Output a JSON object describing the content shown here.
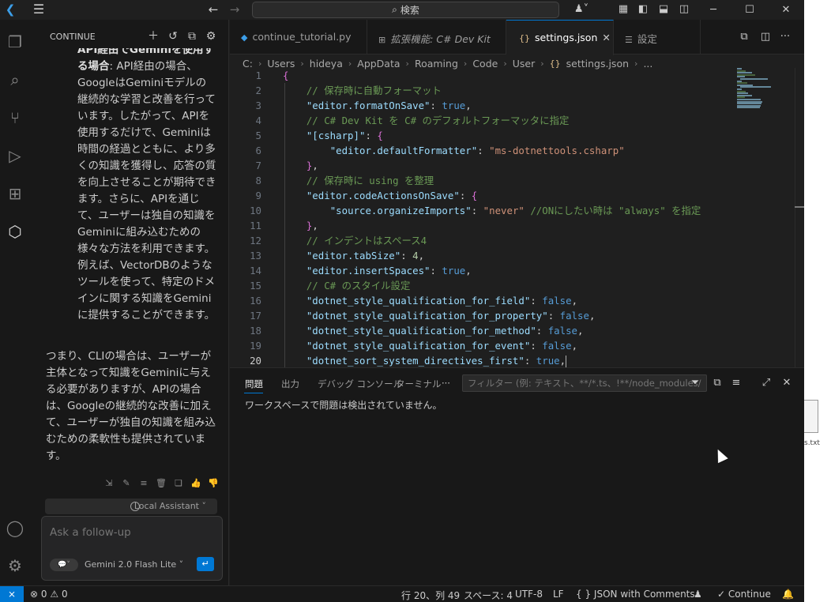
{
  "titlebar": {
    "search_label": "検索",
    "search_icon": "search-icon"
  },
  "sidebar": {
    "title": "CONTINUE",
    "chat_para1_bold": "API経由でGeminiを使用する場合",
    "chat_para1": ": API経由の場合、GoogleはGeminiモデルの継続的な学習と改善を行っています。したがって、APIを使用するだけで、Geminiは時間の経過とともに、より多くの知識を獲得し、応答の質を向上させることが期待できます。さらに、APIを通じて、ユーザーは独自の知識をGeminiに組み込むための様々な方法を利用できます。例えば、VectorDBのようなツールを使って、特定のドメインに関する知識をGeminiに提供することができます。",
    "chat_para2": "つまり、CLIの場合は、ユーザーが主体となって知識をGeminiに与える必要がありますが、APIの場合は、Googleの継続的な改善に加えて、ユーザーが独自の知識を組み込むための柔軟性も提供されています。",
    "assistant_label": "Local Assistant",
    "input_placeholder": "Ask a follow-up",
    "model_label": "Gemini 2.0 Flash Lite"
  },
  "tabs": [
    {
      "label": "continue_tutorial.py",
      "icon": "python-icon"
    },
    {
      "label": "拡張機能: C# Dev Kit",
      "icon": "extensions-icon"
    },
    {
      "label": "settings.json",
      "icon": "json-icon"
    },
    {
      "label": "設定",
      "icon": "settings-icon"
    }
  ],
  "breadcrumb": [
    "C:",
    "Users",
    "hideya",
    "AppData",
    "Roaming",
    "Code",
    "User",
    "settings.json",
    "..."
  ],
  "code_lines": [
    {
      "n": "1",
      "t": "{"
    },
    {
      "n": "2",
      "t": "    // 保存時に自動フォーマット"
    },
    {
      "n": "3",
      "t": "    \"editor.formatOnSave\": true,"
    },
    {
      "n": "4",
      "t": "    // C# Dev Kit を C# のデフォルトフォーマッタに指定"
    },
    {
      "n": "5",
      "t": "    \"[csharp]\": {"
    },
    {
      "n": "6",
      "t": "        \"editor.defaultFormatter\": \"ms-dotnettools.csharp\""
    },
    {
      "n": "7",
      "t": "    },"
    },
    {
      "n": "8",
      "t": "    // 保存時に using を整理"
    },
    {
      "n": "9",
      "t": "    \"editor.codeActionsOnSave\": {"
    },
    {
      "n": "10",
      "t": "        \"source.organizeImports\": \"never\" //ONにしたい時は \"always\" を指定"
    },
    {
      "n": "11",
      "t": "    },"
    },
    {
      "n": "12",
      "t": "    // インデントはスペース4"
    },
    {
      "n": "13",
      "t": "    \"editor.tabSize\": 4,"
    },
    {
      "n": "14",
      "t": "    \"editor.insertSpaces\": true,"
    },
    {
      "n": "15",
      "t": "    // C# のスタイル設定"
    },
    {
      "n": "16",
      "t": "    \"dotnet_style_qualification_for_field\": false,"
    },
    {
      "n": "17",
      "t": "    \"dotnet_style_qualification_for_property\": false,"
    },
    {
      "n": "18",
      "t": "    \"dotnet_style_qualification_for_method\": false,"
    },
    {
      "n": "19",
      "t": "    \"dotnet_style_qualification_for_event\": false,"
    },
    {
      "n": "20",
      "t": "    \"dotnet_sort_system_directives_first\": true,"
    }
  ],
  "panel": {
    "tabs": [
      "問題",
      "出力",
      "デバッグ コンソール",
      "ターミナル"
    ],
    "more": "···",
    "filter_placeholder": "フィルター (例: テキスト、**/*.ts、!**/node_modules/**)",
    "message": "ワークスペースで問題は検出されていません。"
  },
  "statusbar": {
    "remote": "⨯",
    "errors": "0",
    "warnings": "0",
    "position": "行 20、列 49",
    "spaces": "スペース: 4",
    "encoding": "UTF-8",
    "eol": "LF",
    "language": "JSON with Comments",
    "continue": "Continue"
  },
  "desktop": {
    "file_label": "s.txt"
  },
  "colors": {
    "accent": "#0078d4",
    "key": "#9cdcfe",
    "string": "#ce9178",
    "bool": "#569cd6",
    "number": "#b5cea8",
    "comment": "#6a9955"
  }
}
